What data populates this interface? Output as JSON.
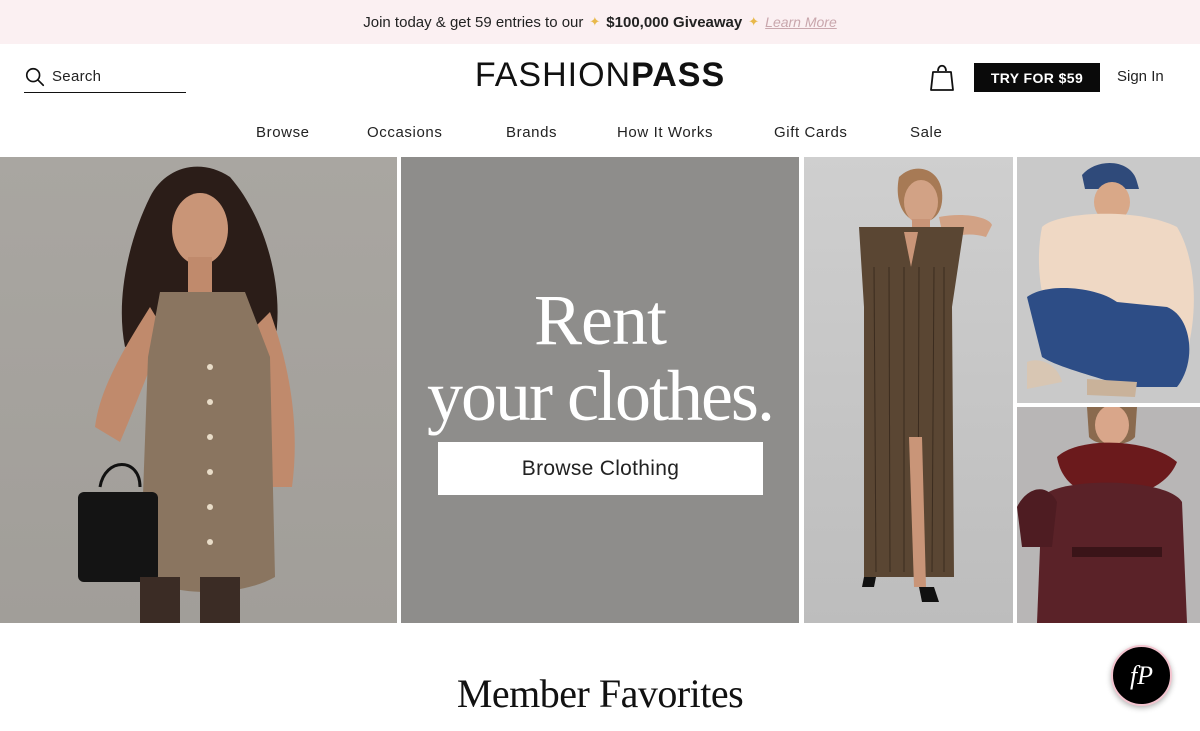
{
  "promo": {
    "text": "Join today & get 59 entries to our",
    "amount": "$100,000 Giveaway",
    "learn_more": "Learn More"
  },
  "header": {
    "search_label": "Search",
    "logo_light": "FASHION",
    "logo_bold": "PASS",
    "try_button": "TRY FOR $59",
    "sign_in": "Sign In"
  },
  "nav": {
    "items": [
      "Browse",
      "Occasions",
      "Brands",
      "How It Works",
      "Gift Cards",
      "Sale"
    ]
  },
  "hero": {
    "title_line1": "Rent",
    "title_line2": "your clothes.",
    "cta": "Browse Clothing"
  },
  "section": {
    "title": "Member Favorites"
  },
  "chat": {
    "label": "fP"
  },
  "colors": {
    "promo_bg": "#fbf0f2",
    "primary_button": "#0a0a0a",
    "hero_center_bg": "#8e8d8b",
    "chat_border": "#f3c4cf"
  }
}
